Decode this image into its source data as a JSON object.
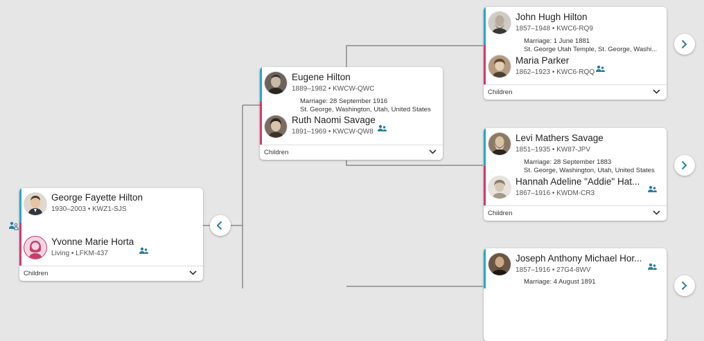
{
  "colors": {
    "male_bar": "#2aa6c4",
    "female_bar": "#cd3d6c",
    "icon": "#2b7d9a",
    "connector": "#8a8a8a"
  },
  "children_label": "Children",
  "icons": {
    "collapse": "chevron-left-icon",
    "expand": "chevron-right-icon",
    "children_toggle": "chevron-down-icon",
    "couple": "people-icon",
    "relationship": "person-link-icon"
  },
  "couples": [
    {
      "husband": {
        "name": "George Fayette Hilton",
        "meta": "1930–2003 • KWZ1-SJS"
      },
      "wife": {
        "name": "Yvonne Marie Horta",
        "meta": "Living • LFKM-437"
      }
    },
    {
      "husband": {
        "name": "Eugene Hilton",
        "meta": "1889–1982 • KWCW-QWC"
      },
      "marriage_date": "Marriage: 28 September 1916",
      "marriage_place": "St. George, Washington, Utah, United States",
      "wife": {
        "name": "Ruth Naomi Savage",
        "meta": "1891–1969 • KWCW-QW8"
      }
    },
    {
      "husband": {
        "name": "John Hugh Hilton",
        "meta": "1857–1948 • KWC6-RQ9"
      },
      "marriage_date": "Marriage: 1 June 1881",
      "marriage_place": "St. George Utah Temple, St. George, Washi...",
      "wife": {
        "name": "Maria Parker",
        "meta": "1862–1923 • KWC6-RQQ"
      }
    },
    {
      "husband": {
        "name": "Levi Mathers Savage",
        "meta": "1851–1935 • KW87-JPV"
      },
      "marriage_date": "Marriage: 28 September 1883",
      "marriage_place": "St. George, Washington, Utah, United States",
      "wife": {
        "name": "Hannah Adeline \"Addie\" Hat...",
        "meta": "1867–1916 • KWDM-CR3"
      }
    },
    {
      "husband": {
        "name": "Joseph Anthony Michael Hor...",
        "meta": "1857–1916 • 27G4-8WV"
      },
      "marriage_date": "Marriage: 4 August 1891"
    }
  ]
}
